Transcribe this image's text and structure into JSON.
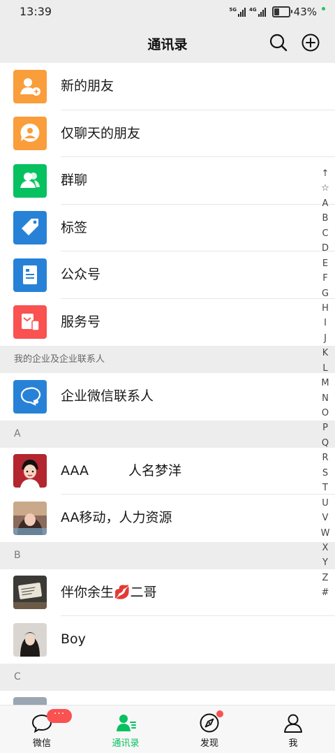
{
  "status_bar": {
    "time": "13:39",
    "signal1_label": "5G",
    "signal2_label": "4G",
    "battery_percent": 43,
    "battery_text": "43%",
    "dot_color": "#2bc25a"
  },
  "header": {
    "title": "通讯录",
    "search_icon": "search-icon",
    "add_icon": "plus-circle-icon"
  },
  "function_entries": [
    {
      "label": "新的朋友",
      "icon": "add-friend-icon",
      "color": "#fa9d3b"
    },
    {
      "label": "仅聊天的朋友",
      "icon": "chat-only-friend-icon",
      "color": "#fa9d3b"
    },
    {
      "label": "群聊",
      "icon": "group-chat-icon",
      "color": "#07c160"
    },
    {
      "label": "标签",
      "icon": "tag-icon",
      "color": "#2782d7"
    },
    {
      "label": "公众号",
      "icon": "official-account-icon",
      "color": "#2782d7"
    },
    {
      "label": "服务号",
      "icon": "service-account-icon",
      "color": "#fa5151"
    }
  ],
  "enterprise_section": {
    "header": "我的企业及企业联系人",
    "item_label": "企业微信联系人",
    "icon": "work-chat-icon",
    "color": "#2782d7"
  },
  "contact_groups": [
    {
      "letter": "A",
      "contacts": [
        {
          "name": "AAA　　　人名梦洋",
          "avatar": "cartoon-avatar"
        },
        {
          "name": "AA移动，人力资源",
          "avatar": "photo-avatar"
        }
      ]
    },
    {
      "letter": "B",
      "contacts": [
        {
          "name": "伴你余生💋二哥",
          "avatar": "note-photo-avatar"
        },
        {
          "name": "Boy",
          "avatar": "portrait-avatar"
        }
      ]
    },
    {
      "letter": "C",
      "contacts": []
    }
  ],
  "index_bar": [
    "↑",
    "☆",
    "A",
    "B",
    "C",
    "D",
    "E",
    "F",
    "G",
    "H",
    "I",
    "J",
    "K",
    "L",
    "M",
    "N",
    "O",
    "P",
    "Q",
    "R",
    "S",
    "T",
    "U",
    "V",
    "W",
    "X",
    "Y",
    "Z",
    "#"
  ],
  "tab_bar": {
    "tabs": [
      {
        "label": "微信",
        "icon": "chat-bubble-icon"
      },
      {
        "label": "通讯录",
        "icon": "contacts-icon",
        "active": true
      },
      {
        "label": "发现",
        "icon": "compass-icon"
      },
      {
        "label": "我",
        "icon": "person-icon"
      }
    ],
    "chat_badge": "···",
    "accent_color": "#07c160"
  }
}
